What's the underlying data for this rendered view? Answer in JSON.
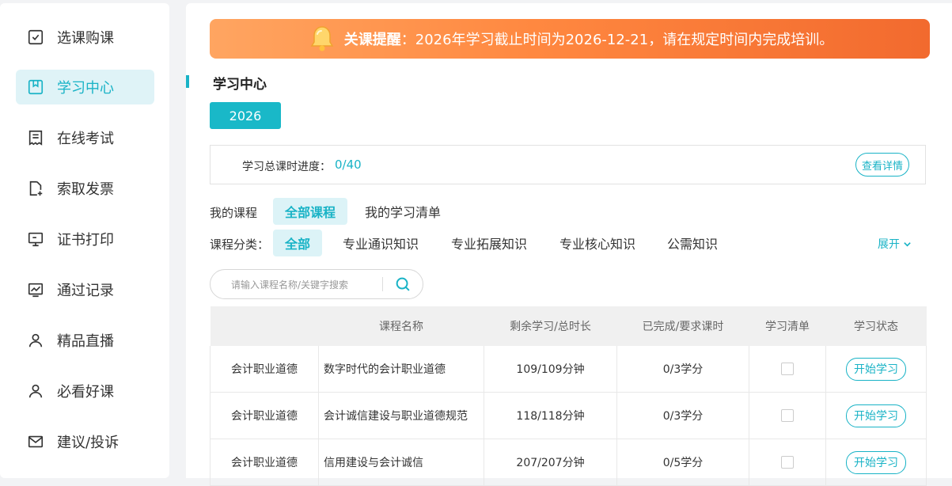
{
  "sidebar": {
    "items": [
      {
        "label": "选课购课",
        "icon": "checkbox-icon"
      },
      {
        "label": "学习中心",
        "icon": "bookmark-icon",
        "active": true
      },
      {
        "label": "在线考试",
        "icon": "exam-doc-icon"
      },
      {
        "label": "索取发票",
        "icon": "invoice-add-icon"
      },
      {
        "label": "证书打印",
        "icon": "monitor-cert-icon"
      },
      {
        "label": "通过记录",
        "icon": "chart-icon"
      },
      {
        "label": "精品直播",
        "icon": "user-icon"
      },
      {
        "label": "必看好课",
        "icon": "user-icon"
      },
      {
        "label": "建议/投诉",
        "icon": "mail-icon"
      }
    ]
  },
  "banner": {
    "highlight": "关课提醒",
    "message": "：2026年学习截止时间为2026-12-21，请在规定时间内完成培训。"
  },
  "section": {
    "title": "学习中心"
  },
  "year": "2026",
  "progress": {
    "label": "学习总课时进度：",
    "value": "0/40",
    "detail_button": "查看详情"
  },
  "filters": {
    "my_courses_label": "我的课程",
    "my_courses_tabs": [
      "全部课程",
      "我的学习清单"
    ],
    "category_label": "课程分类：",
    "categories": [
      "全部",
      "专业通识知识",
      "专业拓展知识",
      "专业核心知识",
      "公需知识"
    ],
    "expand_label": "展开"
  },
  "search": {
    "placeholder": "请输入课程名称/关键字搜索"
  },
  "table": {
    "headers": [
      "",
      "课程名称",
      "剩余学习/总时长",
      "已完成/要求课时",
      "学习清单",
      "学习状态"
    ],
    "rows": [
      {
        "category": "会计职业道德",
        "name": "数字时代的会计职业道德",
        "duration": "109/109分钟",
        "credits": "0/3学分",
        "action": "开始学习"
      },
      {
        "category": "会计职业道德",
        "name": "会计诚信建设与职业道德规范",
        "duration": "118/118分钟",
        "credits": "0/3学分",
        "action": "开始学习"
      },
      {
        "category": "会计职业道德",
        "name": "信用建设与会计诚信",
        "duration": "207/207分钟",
        "credits": "0/5学分",
        "action": "开始学习"
      }
    ]
  },
  "colors": {
    "accent": "#19b3c6",
    "banner_start": "#ffa561",
    "banner_end": "#f26a2e"
  }
}
